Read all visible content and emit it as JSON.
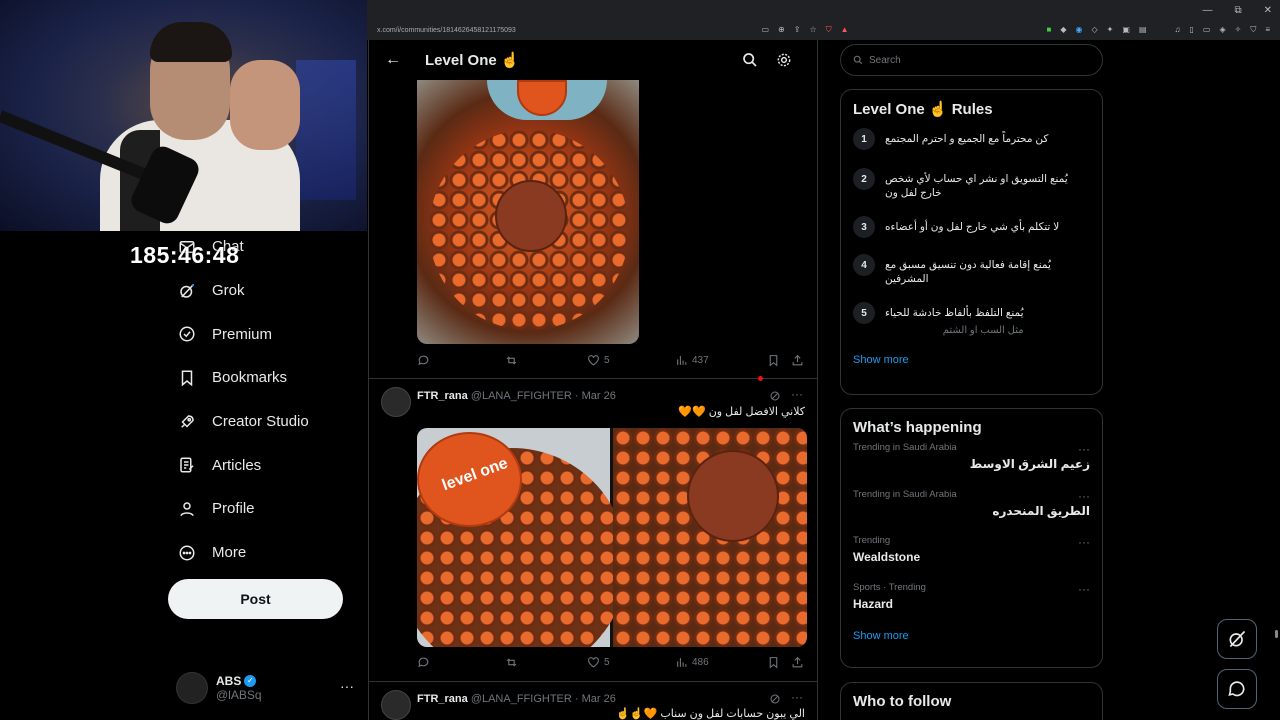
{
  "overlay": {
    "timer": "185:46:48"
  },
  "browser": {
    "url": "x.com/i/communities/1814626458121175093",
    "window_controls": [
      "—",
      "⧉",
      "✕"
    ]
  },
  "nav": {
    "items": [
      {
        "label": "Chat",
        "icon": "envelope-icon"
      },
      {
        "label": "Grok",
        "icon": "grok-icon"
      },
      {
        "label": "Premium",
        "icon": "premium-icon"
      },
      {
        "label": "Bookmarks",
        "icon": "bookmark-icon"
      },
      {
        "label": "Creator Studio",
        "icon": "rocket-icon"
      },
      {
        "label": "Articles",
        "icon": "article-icon"
      },
      {
        "label": "Profile",
        "icon": "person-icon"
      },
      {
        "label": "More",
        "icon": "more-circle-icon"
      }
    ],
    "post_label": "Post",
    "account": {
      "name": "ABS",
      "handle": "@lABSq",
      "more": "···"
    }
  },
  "main": {
    "header": {
      "back": "←",
      "title": "Level One ☝️"
    },
    "post1": {
      "likes": "5",
      "views": "437"
    },
    "post2": {
      "name": "FTR_rana",
      "handle": "@LANA_FFIGHTER",
      "date": "· Mar 26",
      "text": "كلاني الافضل لفل ون 🧡🧡",
      "likes": "5",
      "views": "486",
      "more": "···"
    },
    "post3": {
      "name": "FTR_rana",
      "handle": "@LANA_FFIGHTER",
      "date": "· Mar 26",
      "text": "الي يبون حسابات لفل ون سناب 🧡☝️☝️",
      "more": "···"
    },
    "image_text": "level one"
  },
  "right": {
    "search_placeholder": "Search",
    "rules": {
      "title": "Level One ☝️ Rules",
      "items": [
        {
          "num": "1",
          "text": "كن محترماً مع الجميع و احترم المجتمع"
        },
        {
          "num": "2",
          "text": "يُمنع التسويق او نشر اي حساب لأي شخص خارج لفل ون"
        },
        {
          "num": "3",
          "text": "لا تتكلم بأي شي خارج لفل ون أو أعضاءه"
        },
        {
          "num": "4",
          "text": "يُمنع إقامة فعالية دون تنسيق مسبق مع المشرفين"
        },
        {
          "num": "5",
          "text": "يُمنع التلفظ بألفاظ خادشة للحياء",
          "sub": "مثل السب او الشتم"
        }
      ],
      "show_more": "Show more"
    },
    "happening": {
      "title": "What’s happening",
      "trends": [
        {
          "context": "Trending in Saudi Arabia",
          "title": "زعيم الشرق الاوسط",
          "rtl": true
        },
        {
          "context": "Trending in Saudi Arabia",
          "title": "الطريق المنحدره",
          "rtl": true
        },
        {
          "context": "Trending",
          "title": "Wealdstone",
          "rtl": false
        },
        {
          "context": "Sports · Trending",
          "title": "Hazard",
          "rtl": false
        }
      ],
      "dots": "···",
      "show_more": "Show more"
    },
    "follow": {
      "title": "Who to follow"
    }
  }
}
